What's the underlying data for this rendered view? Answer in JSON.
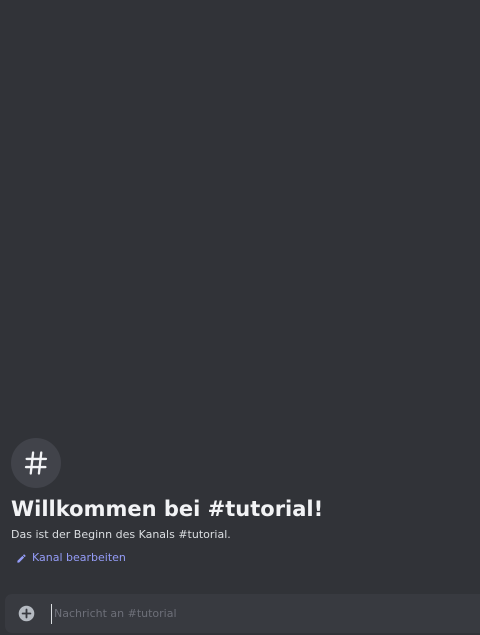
{
  "channel": {
    "welcome_title": "Willkommen bei #tutorial!",
    "welcome_subtitle": "Das ist der Beginn des Kanals #tutorial.",
    "edit_label": "Kanal bearbeiten",
    "icon": "hash-icon"
  },
  "composer": {
    "placeholder": "Nachricht an #tutorial",
    "value": "",
    "plus_icon": "plus-circle-icon"
  },
  "colors": {
    "background": "#313338",
    "composer_background": "#383a40",
    "icon_circle": "#41434a",
    "link": "#949cf7",
    "title": "#f2f3f5"
  }
}
